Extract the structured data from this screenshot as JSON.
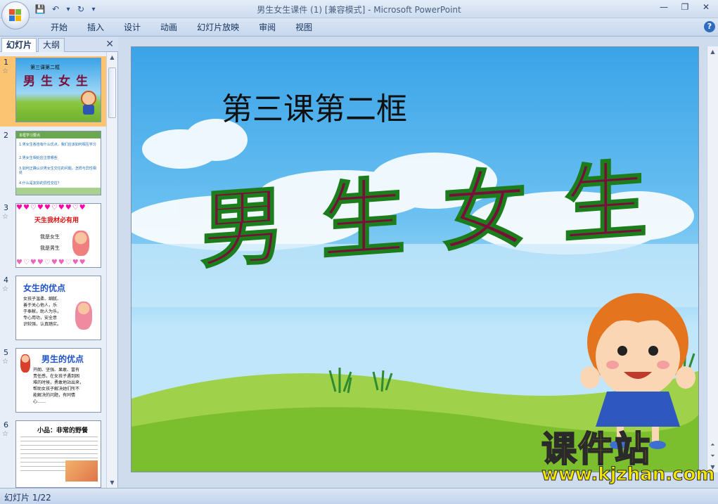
{
  "window": {
    "title": "男生女生课件 (1) [兼容模式] - Microsoft PowerPoint",
    "controls": {
      "minimize": "—",
      "restore": "❐",
      "close": "✕"
    }
  },
  "quick_access": {
    "save": "💾",
    "undo": "↶",
    "undo_menu": "▾",
    "redo": "↻",
    "customize": "▾"
  },
  "ribbon": {
    "tabs": [
      "开始",
      "插入",
      "设计",
      "动画",
      "幻灯片放映",
      "审阅",
      "视图"
    ],
    "help": "?"
  },
  "left_pane": {
    "tabs": [
      "幻灯片",
      "大纲"
    ],
    "close": "✕",
    "slides": [
      {
        "number": "1",
        "title": "第三课第二框",
        "main": "男生女生",
        "selected": true
      },
      {
        "number": "2",
        "lines": [
          "本框学习要点",
          "1.男女生各自有什么优点，我们应该如何相互学习",
          "2.男女生相处应注意哪些",
          "3.如何正确认识男女生交往的问题，怎样与异性相处",
          "4.什么是友好的异性交往？"
        ]
      },
      {
        "number": "3",
        "title": "天生我材必有用",
        "lines": [
          "我是女生",
          "我是男生"
        ]
      },
      {
        "number": "4",
        "title": "女生的优点",
        "lines": [
          "女孩子温柔、细腻、",
          "善于关心他人，乐",
          "于奉献，助人为乐，",
          "专心用功，安全意",
          "识较强，认真踏实。"
        ]
      },
      {
        "number": "5",
        "title": "男生的优点",
        "lines": [
          "开朗、坚强、果敢、富有",
          "责任感，在女孩子遇到困",
          "难的时候，勇敢地站出来，",
          "帮助女孩子解决她们所不",
          "能解决的问题，有同情",
          "心……"
        ]
      },
      {
        "number": "6",
        "title": "小品：非常的野餐"
      }
    ]
  },
  "slide": {
    "subtitle": "第三课第二框",
    "title": "男生女生",
    "watermark_big": "课件站",
    "watermark_url": "www.kjzhan.com"
  },
  "status": {
    "text": "幻灯片 1/22"
  },
  "colors": {
    "title_fill": "#7a0e3a",
    "title_outline": "#1b7d1b",
    "selected_thumb": "#fbc473",
    "watermark": "#f3e600"
  }
}
